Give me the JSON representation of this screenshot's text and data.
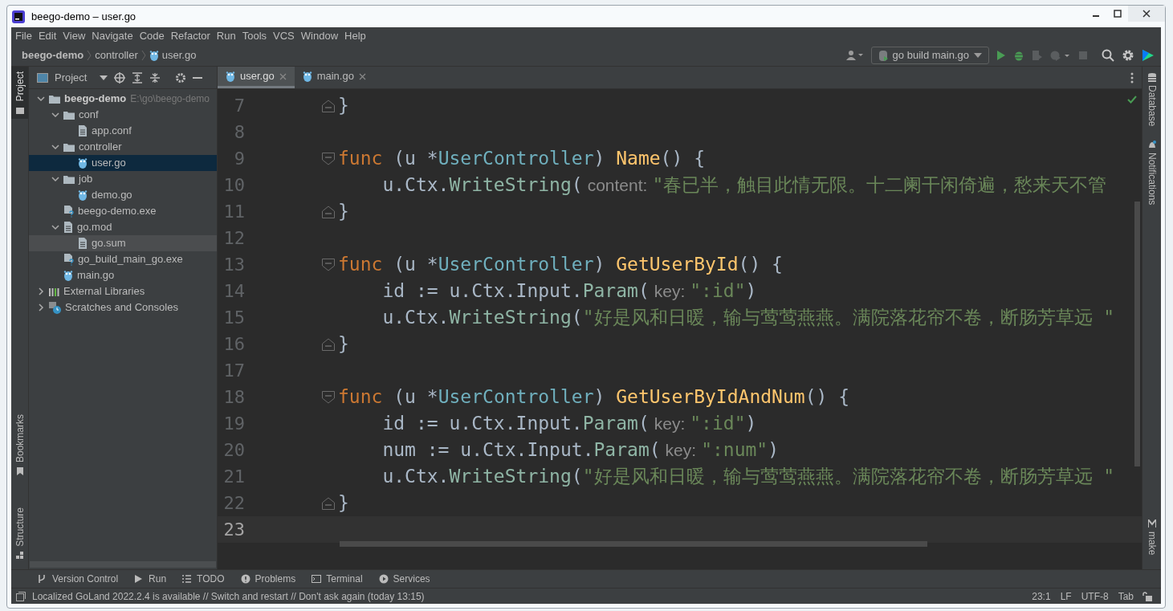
{
  "window": {
    "title": "beego-demo – user.go"
  },
  "menu": [
    "File",
    "Edit",
    "View",
    "Navigate",
    "Code",
    "Refactor",
    "Run",
    "Tools",
    "VCS",
    "Window",
    "Help"
  ],
  "breadcrumbs": [
    "beego-demo",
    "controller",
    "user.go"
  ],
  "toolbar": {
    "run_config": "go build main.go"
  },
  "left_stripe": [
    {
      "label": "Project",
      "selected": true
    },
    {
      "label": "Bookmarks",
      "selected": false
    },
    {
      "label": "Structure",
      "selected": false
    }
  ],
  "project_panel": {
    "title": "Project"
  },
  "tree": [
    {
      "name": "beego-demo",
      "path": "E:\\go\\beego-demo",
      "kind": "folder",
      "expanded": true,
      "selected": false,
      "hovered": false,
      "children": [
        {
          "name": "conf",
          "kind": "folder",
          "expanded": true,
          "selected": false,
          "hovered": false,
          "children": [
            {
              "name": "app.conf",
              "kind": "text",
              "selected": false,
              "hovered": false
            }
          ]
        },
        {
          "name": "controller",
          "kind": "folder",
          "expanded": true,
          "selected": false,
          "hovered": false,
          "children": [
            {
              "name": "user.go",
              "kind": "go",
              "selected": true,
              "hovered": false
            }
          ]
        },
        {
          "name": "job",
          "kind": "folder",
          "expanded": true,
          "selected": false,
          "hovered": false,
          "children": [
            {
              "name": "demo.go",
              "kind": "go",
              "selected": false,
              "hovered": false
            }
          ]
        },
        {
          "name": "beego-demo.exe",
          "kind": "unknown",
          "selected": false,
          "hovered": false
        },
        {
          "name": "go.mod",
          "kind": "text",
          "expanded": true,
          "selected": false,
          "hovered": false,
          "children": [
            {
              "name": "go.sum",
              "kind": "text",
              "selected": false,
              "hovered": true
            }
          ]
        },
        {
          "name": "go_build_main_go.exe",
          "kind": "unknown",
          "selected": false,
          "hovered": false
        },
        {
          "name": "main.go",
          "kind": "go",
          "selected": false,
          "hovered": false
        }
      ]
    },
    {
      "name": "External Libraries",
      "kind": "libraries",
      "expanded": false,
      "selected": false,
      "hovered": false
    },
    {
      "name": "Scratches and Consoles",
      "kind": "scratches",
      "expanded": false,
      "selected": false,
      "hovered": false
    }
  ],
  "editor_tabs": [
    {
      "label": "user.go",
      "selected": true
    },
    {
      "label": "main.go",
      "selected": false
    }
  ],
  "code_lines": [
    {
      "number": "7",
      "kind": "fold_end",
      "current": false,
      "tokens": [
        {
          "kind": "plain",
          "text": "}"
        }
      ]
    },
    {
      "number": "8",
      "kind": "plain",
      "current": false
    },
    {
      "number": "9",
      "kind": "fold_start",
      "current": false,
      "tokens": [
        {
          "kind": "keyword",
          "text": "func"
        },
        {
          "kind": "plain",
          "text": " (u *"
        },
        {
          "kind": "type",
          "text": "UserController"
        },
        {
          "kind": "plain",
          "text": ") "
        },
        {
          "kind": "function",
          "text": "Name"
        },
        {
          "kind": "plain",
          "text": "() {"
        }
      ]
    },
    {
      "number": "10",
      "kind": "plain",
      "current": false,
      "tokens": [
        {
          "kind": "plain",
          "text": "    u.Ctx."
        },
        {
          "kind": "call",
          "text": "WriteString"
        },
        {
          "kind": "plain",
          "text": "("
        },
        {
          "kind": "hint",
          "text": "content:"
        },
        {
          "kind": "string",
          "text": "\"春已半，触目此情无限。十二阑干闲倚遍，愁来天不管"
        }
      ]
    },
    {
      "number": "11",
      "kind": "fold_end",
      "current": false,
      "tokens": [
        {
          "kind": "plain",
          "text": "}"
        }
      ]
    },
    {
      "number": "12",
      "kind": "plain",
      "current": false
    },
    {
      "number": "13",
      "kind": "fold_start",
      "current": false,
      "tokens": [
        {
          "kind": "keyword",
          "text": "func"
        },
        {
          "kind": "plain",
          "text": " (u *"
        },
        {
          "kind": "type",
          "text": "UserController"
        },
        {
          "kind": "plain",
          "text": ") "
        },
        {
          "kind": "function",
          "text": "GetUserById"
        },
        {
          "kind": "plain",
          "text": "() {"
        }
      ]
    },
    {
      "number": "14",
      "kind": "plain",
      "current": false,
      "tokens": [
        {
          "kind": "plain",
          "text": "    id := u.Ctx.Input."
        },
        {
          "kind": "call",
          "text": "Param"
        },
        {
          "kind": "plain",
          "text": "("
        },
        {
          "kind": "hint",
          "text": "key:"
        },
        {
          "kind": "string",
          "text": "\":id\""
        },
        {
          "kind": "plain",
          "text": ")"
        }
      ]
    },
    {
      "number": "15",
      "kind": "plain",
      "current": false,
      "tokens": [
        {
          "kind": "plain",
          "text": "    u.Ctx."
        },
        {
          "kind": "call",
          "text": "WriteString"
        },
        {
          "kind": "plain",
          "text": "("
        },
        {
          "kind": "string",
          "text": "\"好是风和日暖，输与莺莺燕燕。满院落花帘不卷，断肠芳草远 \""
        }
      ]
    },
    {
      "number": "16",
      "kind": "fold_end",
      "current": false,
      "tokens": [
        {
          "kind": "plain",
          "text": "}"
        }
      ]
    },
    {
      "number": "17",
      "kind": "plain",
      "current": false
    },
    {
      "number": "18",
      "kind": "fold_start",
      "current": false,
      "tokens": [
        {
          "kind": "keyword",
          "text": "func"
        },
        {
          "kind": "plain",
          "text": " (u *"
        },
        {
          "kind": "type",
          "text": "UserController"
        },
        {
          "kind": "plain",
          "text": ") "
        },
        {
          "kind": "function",
          "text": "GetUserByIdAndNum"
        },
        {
          "kind": "plain",
          "text": "() {"
        }
      ]
    },
    {
      "number": "19",
      "kind": "plain",
      "current": false,
      "tokens": [
        {
          "kind": "plain",
          "text": "    id := u.Ctx.Input."
        },
        {
          "kind": "call",
          "text": "Param"
        },
        {
          "kind": "plain",
          "text": "("
        },
        {
          "kind": "hint",
          "text": "key:"
        },
        {
          "kind": "string",
          "text": "\":id\""
        },
        {
          "kind": "plain",
          "text": ")"
        }
      ]
    },
    {
      "number": "20",
      "kind": "plain",
      "current": false,
      "tokens": [
        {
          "kind": "plain",
          "text": "    num := u.Ctx.Input."
        },
        {
          "kind": "call",
          "text": "Param"
        },
        {
          "kind": "plain",
          "text": "("
        },
        {
          "kind": "hint",
          "text": "key:"
        },
        {
          "kind": "string",
          "text": "\":num\""
        },
        {
          "kind": "plain",
          "text": ")"
        }
      ]
    },
    {
      "number": "21",
      "kind": "plain",
      "current": false,
      "tokens": [
        {
          "kind": "plain",
          "text": "    u.Ctx."
        },
        {
          "kind": "call",
          "text": "WriteString"
        },
        {
          "kind": "plain",
          "text": "("
        },
        {
          "kind": "string",
          "text": "\"好是风和日暖，输与莺莺燕燕。满院落花帘不卷，断肠芳草远 \""
        }
      ]
    },
    {
      "number": "22",
      "kind": "fold_end",
      "current": false,
      "tokens": [
        {
          "kind": "plain",
          "text": "}"
        }
      ]
    },
    {
      "number": "23",
      "kind": "plain",
      "current": true
    }
  ],
  "right_stripe": [
    "Database",
    "Notifications",
    "make"
  ],
  "tool_windows": [
    {
      "label": "Version Control",
      "kind": "vcs"
    },
    {
      "label": "Run",
      "kind": "run"
    },
    {
      "label": "TODO",
      "kind": "todo"
    },
    {
      "label": "Problems",
      "kind": "problems"
    },
    {
      "label": "Terminal",
      "kind": "terminal"
    },
    {
      "label": "Services",
      "kind": "services"
    }
  ],
  "status_bar": {
    "message": "Localized GoLand 2022.2.4 is available // Switch and restart // Don't ask again (today 13:15)",
    "items": [
      "23:1",
      "LF",
      "UTF-8",
      "Tab"
    ]
  }
}
